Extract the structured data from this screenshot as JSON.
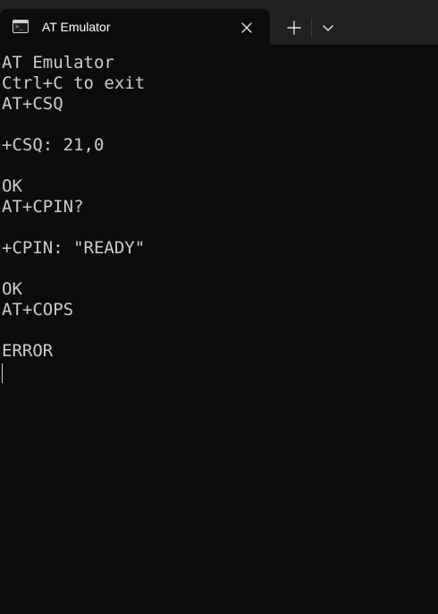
{
  "window": {
    "tab": {
      "title": "AT Emulator",
      "icon": "terminal-icon"
    },
    "controls": {
      "close_icon": "close-icon",
      "new_tab_icon": "plus-icon",
      "dropdown_icon": "chevron-down-icon"
    }
  },
  "terminal": {
    "lines": [
      "AT Emulator",
      "Ctrl+C to exit",
      "AT+CSQ",
      "",
      "+CSQ: 21,0",
      "",
      "OK",
      "AT+CPIN?",
      "",
      "+CPIN: \"READY\"",
      "",
      "OK",
      "AT+COPS",
      "",
      "ERROR"
    ],
    "text_color": "#cccccc",
    "background_color": "#0c0c0c"
  }
}
